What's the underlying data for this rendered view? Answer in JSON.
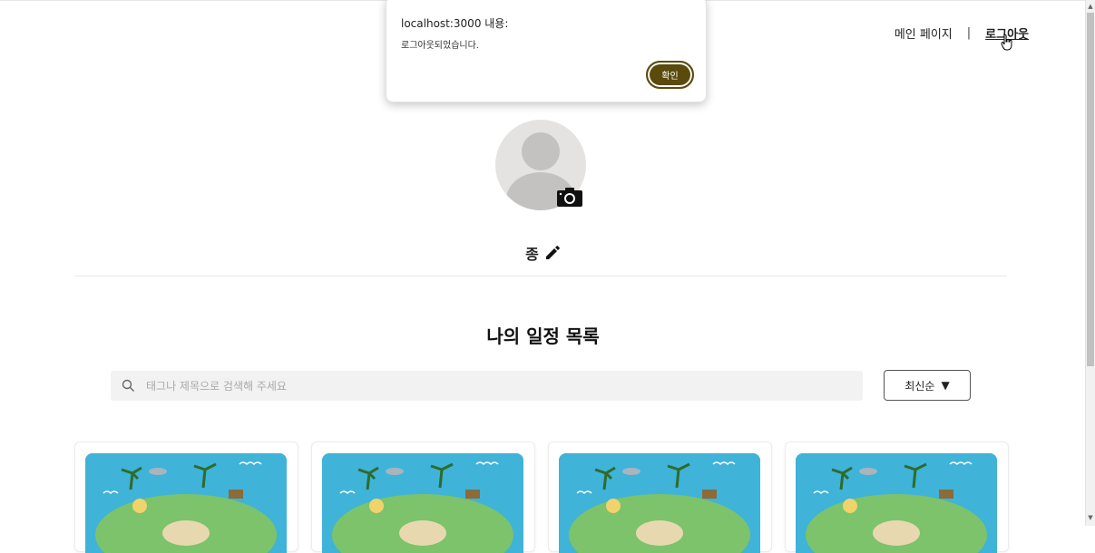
{
  "nav": {
    "main_page": "메인 페이지",
    "separator": "|",
    "logout": "로그아웃"
  },
  "profile": {
    "nickname": "종"
  },
  "schedules": {
    "title": "나의 일정 목록",
    "search_placeholder": "태그나 제목으로 검색해 주세요",
    "sort_label": "최신순",
    "sort_arrow": "▼"
  },
  "dialog": {
    "origin": "localhost:3000 내용:",
    "message": "로그아웃되었습니다.",
    "ok_label": "확인"
  },
  "icons": {
    "search": "search-icon",
    "camera": "camera-icon",
    "edit": "pencil-icon",
    "cursor": "hand-cursor-icon"
  },
  "colors": {
    "accent": "#5a4a0c",
    "thumb_sea": "#3fb3d8",
    "thumb_land": "#7cc36b"
  }
}
